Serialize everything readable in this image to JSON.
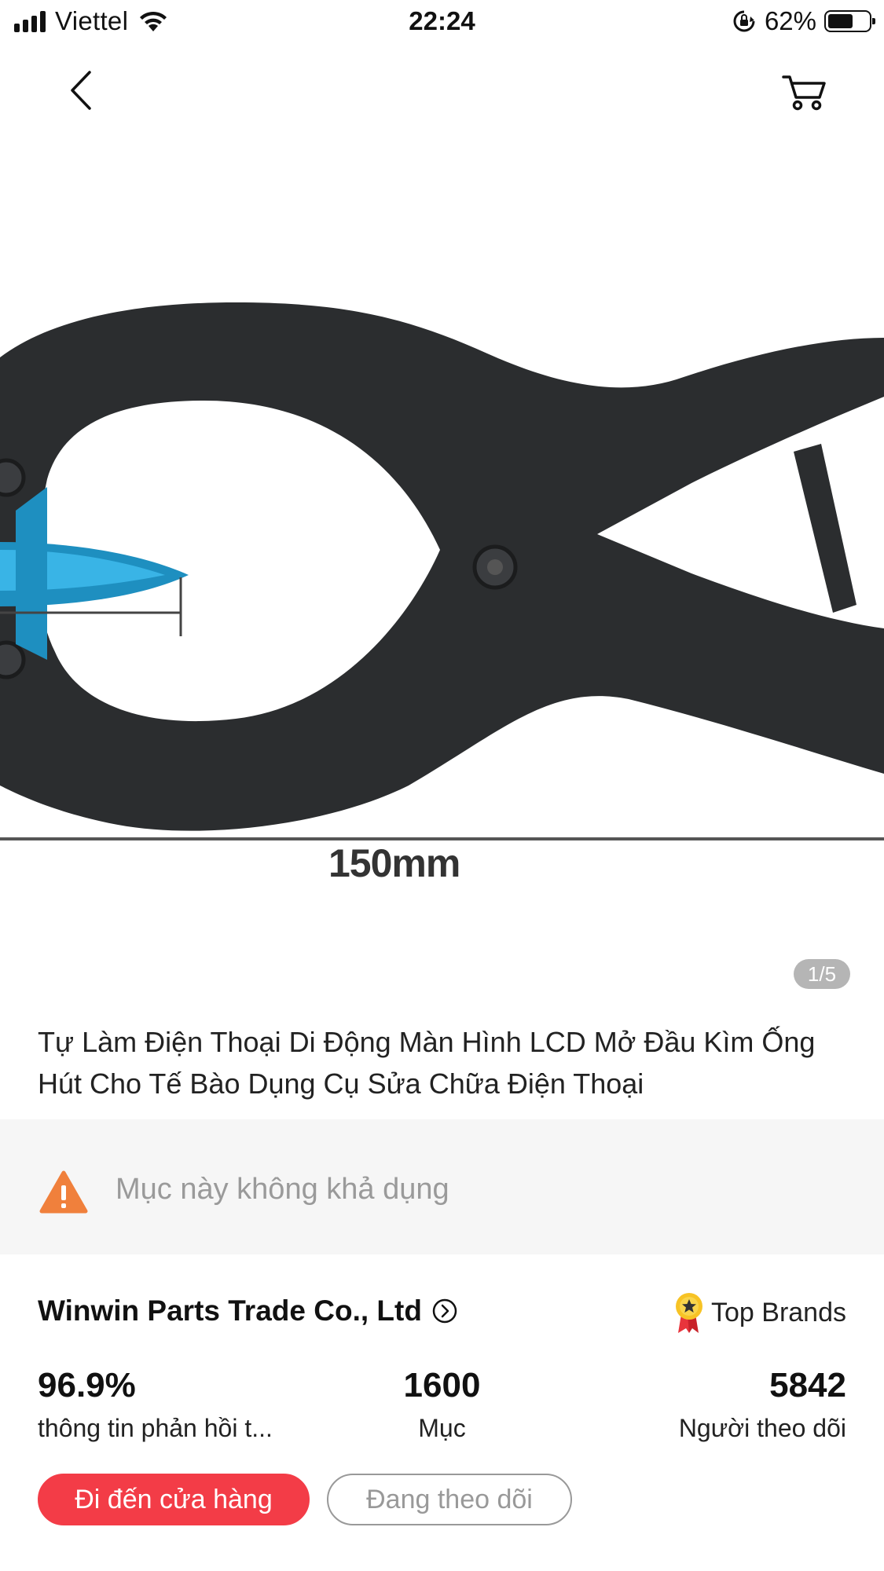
{
  "status_bar": {
    "carrier": "Viettel",
    "time": "22:24",
    "battery_percent": "62%",
    "battery_level": 0.62,
    "icons": [
      "signal-icon",
      "wifi-icon",
      "orientation-lock-icon",
      "battery-icon"
    ]
  },
  "nav": {
    "back_icon": "chevron-left-icon",
    "cart_icon": "cart-icon"
  },
  "product": {
    "image_caption": "150mm",
    "image_counter": "1/5",
    "title": "Tự Làm Điện Thoại Di Động Màn Hình LCD Mở Đầu Kìm Ống Hút Cho Tế Bào Dụng Cụ Sửa Chữa Điện Thoại"
  },
  "availability": {
    "icon": "warning-icon",
    "message": "Mục này không khả dụng",
    "icon_color": "#f0803c"
  },
  "store": {
    "name": "Winwin Parts Trade Co., Ltd",
    "badge_label": "Top Brands",
    "stats": [
      {
        "value": "96.9%",
        "label": "thông tin phản hồi t..."
      },
      {
        "value": "1600",
        "label": "Mục"
      },
      {
        "value": "5842",
        "label": "Người theo dõi"
      }
    ],
    "visit_button": "Đi đến cửa hàng",
    "follow_button": "Đang theo dõi",
    "accent_color": "#f33c47"
  }
}
